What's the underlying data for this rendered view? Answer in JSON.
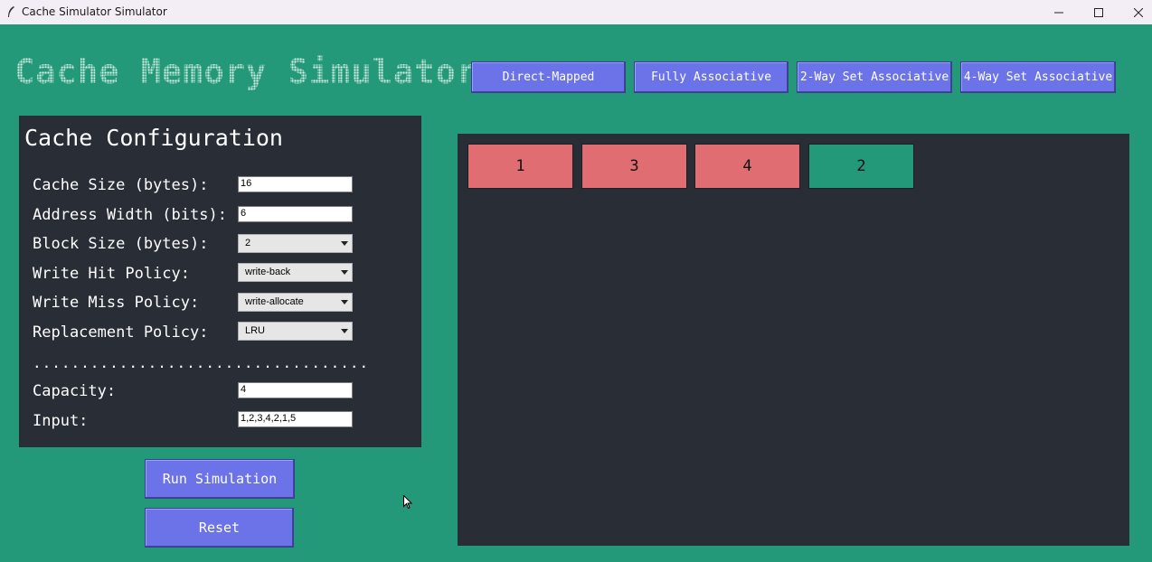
{
  "window": {
    "title": "Cache Simulator Simulator"
  },
  "header": {
    "title": "Cache Memory Simulator",
    "modes": [
      "Direct-Mapped",
      "Fully Associative",
      "2-Way Set Associative",
      "4-Way Set Associative"
    ]
  },
  "config": {
    "title": "Cache Configuration",
    "cache_size": {
      "label": "Cache Size (bytes):",
      "value": "16"
    },
    "address_width": {
      "label": "Address Width (bits):",
      "value": "6"
    },
    "block_size": {
      "label": "Block Size (bytes):",
      "value": "2"
    },
    "write_hit": {
      "label": "Write Hit Policy:",
      "value": "write-back"
    },
    "write_miss": {
      "label": "Write Miss Policy:",
      "value": "write-allocate"
    },
    "replacement": {
      "label": "Replacement Policy:",
      "value": "LRU"
    },
    "separator": "...................................",
    "capacity": {
      "label": "Capacity:",
      "value": "4"
    },
    "input": {
      "label": "Input:",
      "value": "1,2,3,4,2,1,5"
    }
  },
  "actions": {
    "run_label": "Run Simulation",
    "reset_label": "Reset"
  },
  "cache": {
    "blocks": [
      {
        "value": "1",
        "color": "#e06d72"
      },
      {
        "value": "3",
        "color": "#e06d72"
      },
      {
        "value": "4",
        "color": "#e06d72"
      },
      {
        "value": "2",
        "color": "#23997a"
      }
    ]
  },
  "colors": {
    "background": "#23997a",
    "panel": "#282d36",
    "button": "#6c73e8",
    "block_evicted": "#e06d72",
    "block_hit": "#23997a"
  }
}
